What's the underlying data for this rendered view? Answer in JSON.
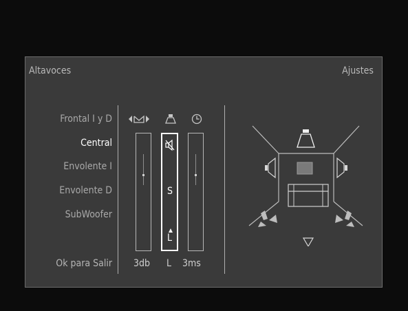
{
  "header": {
    "title": "Altavoces",
    "settings": "Ajustes"
  },
  "speakers": [
    {
      "label": "Frontal I y D",
      "selected": false
    },
    {
      "label": "Central",
      "selected": true
    },
    {
      "label": "Envolente I",
      "selected": false
    },
    {
      "label": "Envolente D",
      "selected": false
    },
    {
      "label": "SubWoofer",
      "selected": false
    }
  ],
  "exit_label": "Ok para Salir",
  "columns": {
    "level": {
      "icon": "balance-arrows-icon",
      "value": "3db"
    },
    "size": {
      "icon": "speaker-icon",
      "value": "L",
      "muted_icon": "speaker-muted-icon",
      "option_s": "S",
      "option_l": "L"
    },
    "delay": {
      "icon": "clock-icon",
      "value": "3ms"
    }
  },
  "colors": {
    "background": "#0c0c0c",
    "panel": "#3a3a3a",
    "text": "#b0b0b0",
    "selected": "#ffffff"
  }
}
